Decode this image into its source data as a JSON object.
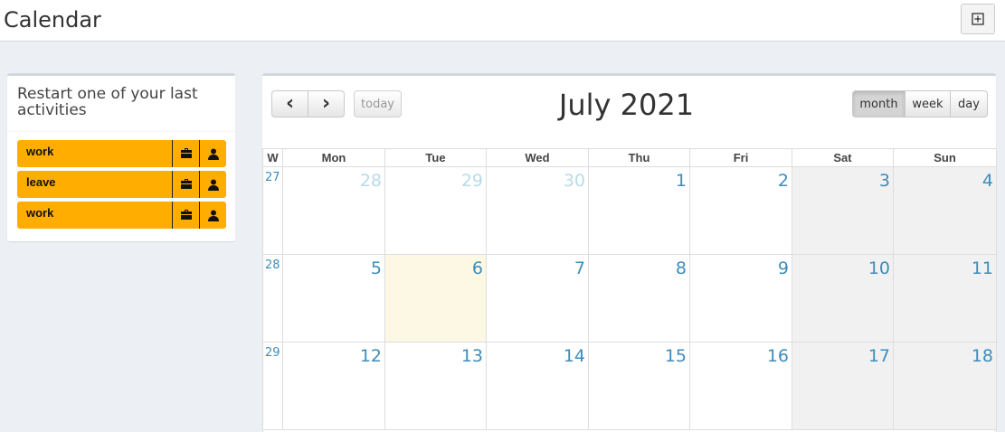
{
  "page": {
    "title": "Calendar"
  },
  "left_panel": {
    "title": "Restart one of your last activities",
    "activities": [
      {
        "label": "work",
        "project_icon": "briefcase-icon",
        "user_icon": "user-icon"
      },
      {
        "label": "leave",
        "project_icon": "briefcase-icon",
        "user_icon": "user-icon"
      },
      {
        "label": "work",
        "project_icon": "briefcase-icon",
        "user_icon": "user-icon"
      }
    ],
    "activity_color": "#ffad00"
  },
  "calendar": {
    "title": "July 2021",
    "prev_label": "‹",
    "next_label": "›",
    "today_label": "today",
    "views": {
      "month": "month",
      "week": "week",
      "day": "day"
    },
    "active_view": "month",
    "week_header": "W",
    "day_headers": [
      "Mon",
      "Tue",
      "Wed",
      "Thu",
      "Fri",
      "Sat",
      "Sun"
    ],
    "weeks": [
      {
        "number": "27",
        "days": [
          "28",
          "29",
          "30",
          "1",
          "2",
          "3",
          "4"
        ]
      },
      {
        "number": "28",
        "days": [
          "5",
          "6",
          "7",
          "8",
          "9",
          "10",
          "11"
        ]
      },
      {
        "number": "29",
        "days": [
          "12",
          "13",
          "14",
          "15",
          "16",
          "17",
          "18"
        ]
      }
    ],
    "today_date": "6",
    "link_color": "#3c8dbc",
    "today_color": "#fcf8e3",
    "weekend_color": "#f1f1f1"
  }
}
